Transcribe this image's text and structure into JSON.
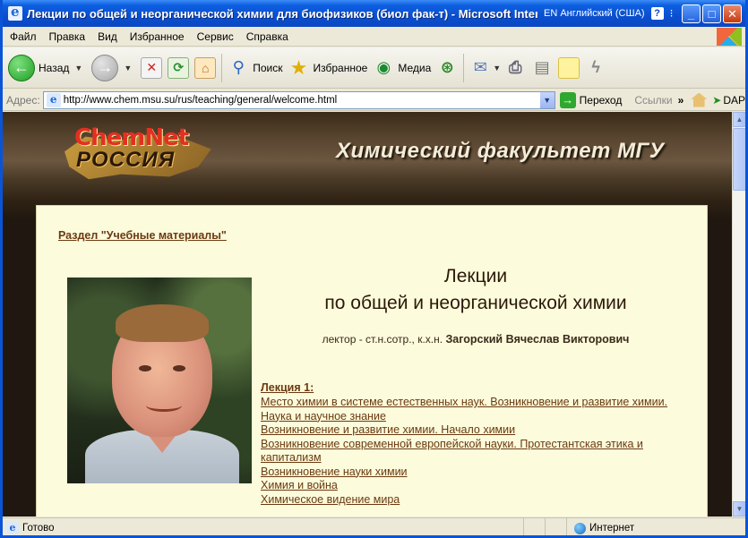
{
  "window": {
    "title": "Лекции по общей и неорганической химии для биофизиков (биол фак-т) - Microsoft Internet Explorer",
    "language": "EN Английский (США)",
    "help_icon": "?",
    "minimize_icon": "_",
    "maximize_icon": "□",
    "close_icon": "✕"
  },
  "menu": [
    "Файл",
    "Правка",
    "Вид",
    "Избранное",
    "Сервис",
    "Справка"
  ],
  "toolbar": {
    "back_label": "Назад",
    "search_label": "Поиск",
    "favorites_label": "Избранное",
    "media_label": "Медиа"
  },
  "address": {
    "label": "Адрес:",
    "url": "http://www.chem.msu.su/rus/teaching/general/welcome.html",
    "go_label": "Переход",
    "links_label": "Ссылки",
    "chevron": "»",
    "dap_label": "DAP"
  },
  "page": {
    "logo_top": "ChemNet",
    "logo_bottom": "РОССИЯ",
    "faculty_title": "Химический факультет МГУ",
    "section_link": "Раздел \"Учебные материалы\"",
    "title_line1": "Лекции",
    "title_line2": "по общей и неорганической химии",
    "lecturer_prefix": "лектор - ст.н.сотр., к.х.н.",
    "lecturer_name": "Загорский Вячеслав Викторович",
    "lecture_heading": "Лекция 1:",
    "topics": [
      "Место химии в системе естественных наук. Возникновение и развитие химии. Наука и научное знание",
      "Возникновение и развитие химии. Начало химии",
      "Возникновение современной европейской науки. Протестантская этика и капитализм",
      "Возникновение науки химии",
      "Химия и война",
      "Химическое видение мира"
    ]
  },
  "status": {
    "text": "Готово",
    "zone": "Интернет"
  }
}
